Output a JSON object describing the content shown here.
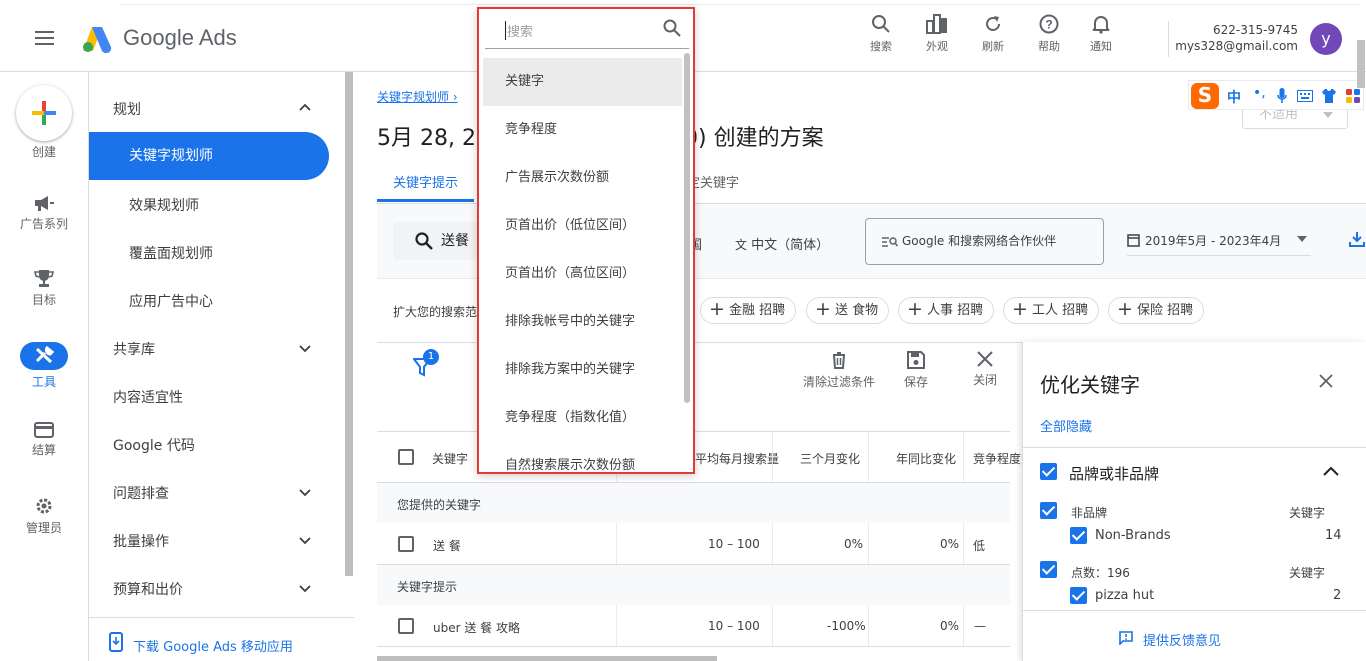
{
  "header": {
    "app_name": "Google Ads",
    "actions": [
      {
        "label": "搜索",
        "icon": "search-icon"
      },
      {
        "label": "外观",
        "icon": "appearance-icon"
      },
      {
        "label": "刷新",
        "icon": "refresh-icon"
      },
      {
        "label": "帮助",
        "icon": "help-icon"
      },
      {
        "label": "通知",
        "icon": "bell-icon"
      }
    ],
    "account_id": "622-315-9745",
    "account_email": "mys328@gmail.com",
    "avatar_letter": "y"
  },
  "rail": {
    "create": "创建",
    "campaigns": "广告系列",
    "goals": "目标",
    "tools": "工具",
    "billing": "结算",
    "admin": "管理员"
  },
  "nav": {
    "planning": "规划",
    "keyword_planner": "关键字规划师",
    "performance_planner": "效果规划师",
    "reach_planner": "覆盖面规划师",
    "app_center": "应用广告中心",
    "shared_library": "共享库",
    "content_suitability": "内容适宜性",
    "google_tag": "Google 代码",
    "troubleshooting": "问题排查",
    "bulk_actions": "批量操作",
    "budgets_bids": "预算和出价",
    "download_app": "下载 Google Ads 移动应用"
  },
  "main": {
    "breadcrumb": "关键字规划师",
    "title_left": "5月 28, 202",
    "title_right": "0) 创建的方案",
    "tab_ideas": "关键字提示",
    "tab_negative": "否定关键字",
    "search_value": "送餐",
    "lang_partial": "国",
    "language": "中文（简体）",
    "network": "Google 和搜索网络合作伙伴",
    "date_range": "2019年5月 - 2023年4月",
    "expand_label": "扩大您的搜索范",
    "chips": [
      "金融 招聘",
      "送 食物",
      "人事 招聘",
      "工人 招聘",
      "保险 招聘"
    ],
    "filter_badge": "1",
    "clear_filters": "清除过滤条件",
    "save": "保存",
    "close": "关闭",
    "columns": [
      "关键字",
      "平均每月搜索量",
      "三个月变化",
      "年同比变化",
      "竞争程度"
    ],
    "group_provided": "您提供的关键字",
    "group_ideas": "关键字提示",
    "rows": [
      {
        "keyword": "送 餐",
        "searches": "10 – 100",
        "three_month": "0%",
        "yoy": "0%",
        "competition": "低"
      },
      {
        "keyword": "uber 送 餐 攻略",
        "searches": "10 – 100",
        "three_month": "-100%",
        "yoy": "0%",
        "competition": "—"
      }
    ]
  },
  "not_applicable": "不适用",
  "refine": {
    "title": "优化关键字",
    "hide_all": "全部隐藏",
    "section": "品牌或非品牌",
    "non_brand": "非品牌",
    "col_keyword": "关键字",
    "non_brands_label": "Non-Brands",
    "non_brands_count": "14",
    "points_label": "点数：196",
    "pizza_label": "pizza hut",
    "pizza_count": "2",
    "feedback": "提供反馈意见"
  },
  "ime": {
    "label": "中"
  },
  "dropdown": {
    "search_placeholder": "搜索",
    "items": [
      "关键字",
      "竞争程度",
      "广告展示次数份额",
      "页首出价（低位区间）",
      "页首出价（高位区间）",
      "排除我帐号中的关键字",
      "排除我方案中的关键字",
      "竞争程度（指数化值）",
      "自然搜索展示次数份额"
    ]
  }
}
